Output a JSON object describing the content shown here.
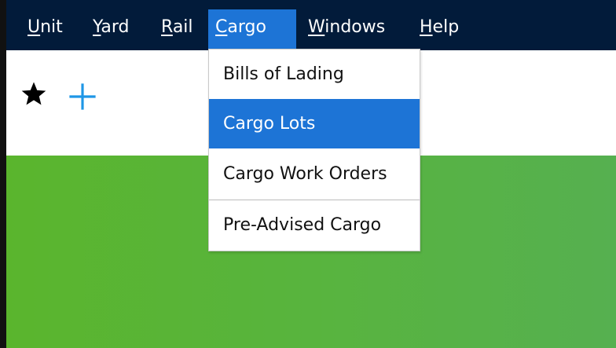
{
  "menubar": {
    "items": [
      {
        "label_first": "U",
        "label_rest": "nit"
      },
      {
        "label_first": "Y",
        "label_rest": "ard"
      },
      {
        "label_first": "R",
        "label_rest": "ail"
      },
      {
        "label_first": "C",
        "label_rest": "argo"
      },
      {
        "label_first": "W",
        "label_rest": "indows"
      },
      {
        "label_first": "H",
        "label_rest": "elp"
      }
    ],
    "active": "Cargo"
  },
  "toolbar": {
    "icons": [
      "star-icon",
      "plus-icon"
    ]
  },
  "cargo_menu": {
    "items": [
      {
        "label": "Bills of Lading"
      },
      {
        "label": "Cargo Lots"
      },
      {
        "label": "Cargo Work Orders"
      },
      {
        "label": "Pre-Advised Cargo"
      }
    ],
    "highlighted": "Cargo Lots"
  },
  "colors": {
    "menubar_bg": "#021b3a",
    "accent": "#1d74d6",
    "content_green": "#58b43e",
    "plus_icon": "#1e96e6"
  }
}
